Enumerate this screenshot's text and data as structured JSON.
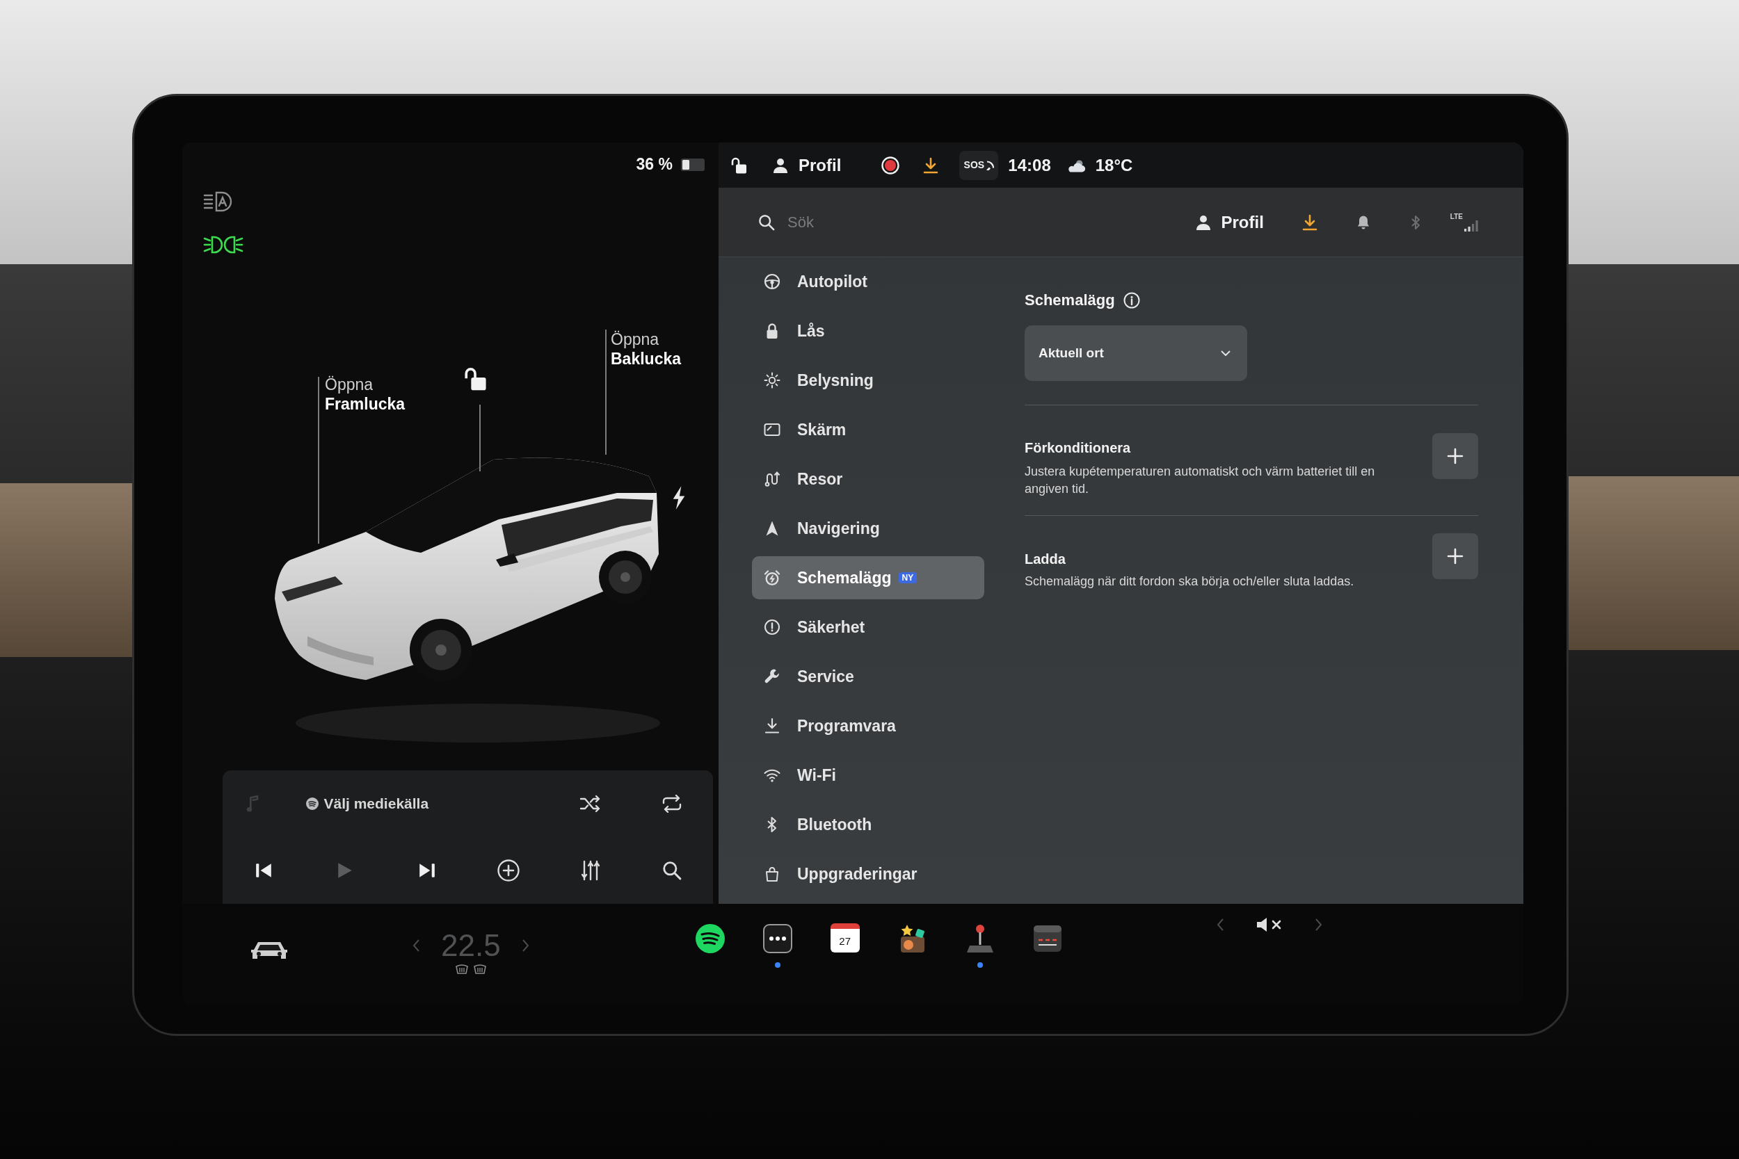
{
  "status_bar": {
    "battery": "36 %",
    "locked": false,
    "profile": "Profil",
    "dashcam_recording": true,
    "sos": "SOS",
    "time": "14:08",
    "weather": "18°C"
  },
  "lights": [
    {
      "kind": "auto_headlights",
      "on": false
    },
    {
      "kind": "parking_lights",
      "on": true
    }
  ],
  "car": {
    "locked": false,
    "labels": [
      {
        "action": "Öppna",
        "part": "Framlucka"
      },
      {
        "action": "Öppna",
        "part": "Baklucka"
      }
    ]
  },
  "media": {
    "source": "Välj mediekälla",
    "play_disabled": true
  },
  "search": {
    "placeholder": "Sök"
  },
  "header": {
    "profile": "Profil",
    "bluetooth_connected": false,
    "network": "LTE"
  },
  "menu": [
    {
      "label": "Autopilot",
      "selected": false
    },
    {
      "label": "Lås",
      "selected": false
    },
    {
      "label": "Belysning",
      "selected": false
    },
    {
      "label": "Skärm",
      "selected": false
    },
    {
      "label": "Resor",
      "selected": false
    },
    {
      "label": "Navigering",
      "selected": false
    },
    {
      "label": "Schemalägg",
      "selected": true,
      "badge": "NY"
    },
    {
      "label": "Säkerhet",
      "selected": false
    },
    {
      "label": "Service",
      "selected": false
    },
    {
      "label": "Programvara",
      "selected": false
    },
    {
      "label": "Wi-Fi",
      "selected": false
    },
    {
      "label": "Bluetooth",
      "selected": false
    },
    {
      "label": "Uppgraderingar",
      "selected": false
    }
  ],
  "schedule": {
    "title": "Schemalägg",
    "location": "Aktuell ort",
    "sections": [
      {
        "title": "Förkonditionera",
        "description": "Justera kupétemperaturen automatiskt och värm batteriet till en angiven tid."
      },
      {
        "title": "Ladda",
        "description": "Schemalägg när ditt fordon ska börja och/eller sluta laddas."
      }
    ]
  },
  "climate": {
    "temperature": "22.5"
  },
  "dock": [
    {
      "running": false
    },
    {
      "running": true
    },
    {
      "date": "27",
      "running": false
    },
    {
      "running": false
    },
    {
      "running": true
    },
    {
      "running": false
    }
  ],
  "volume": {
    "muted": true
  }
}
